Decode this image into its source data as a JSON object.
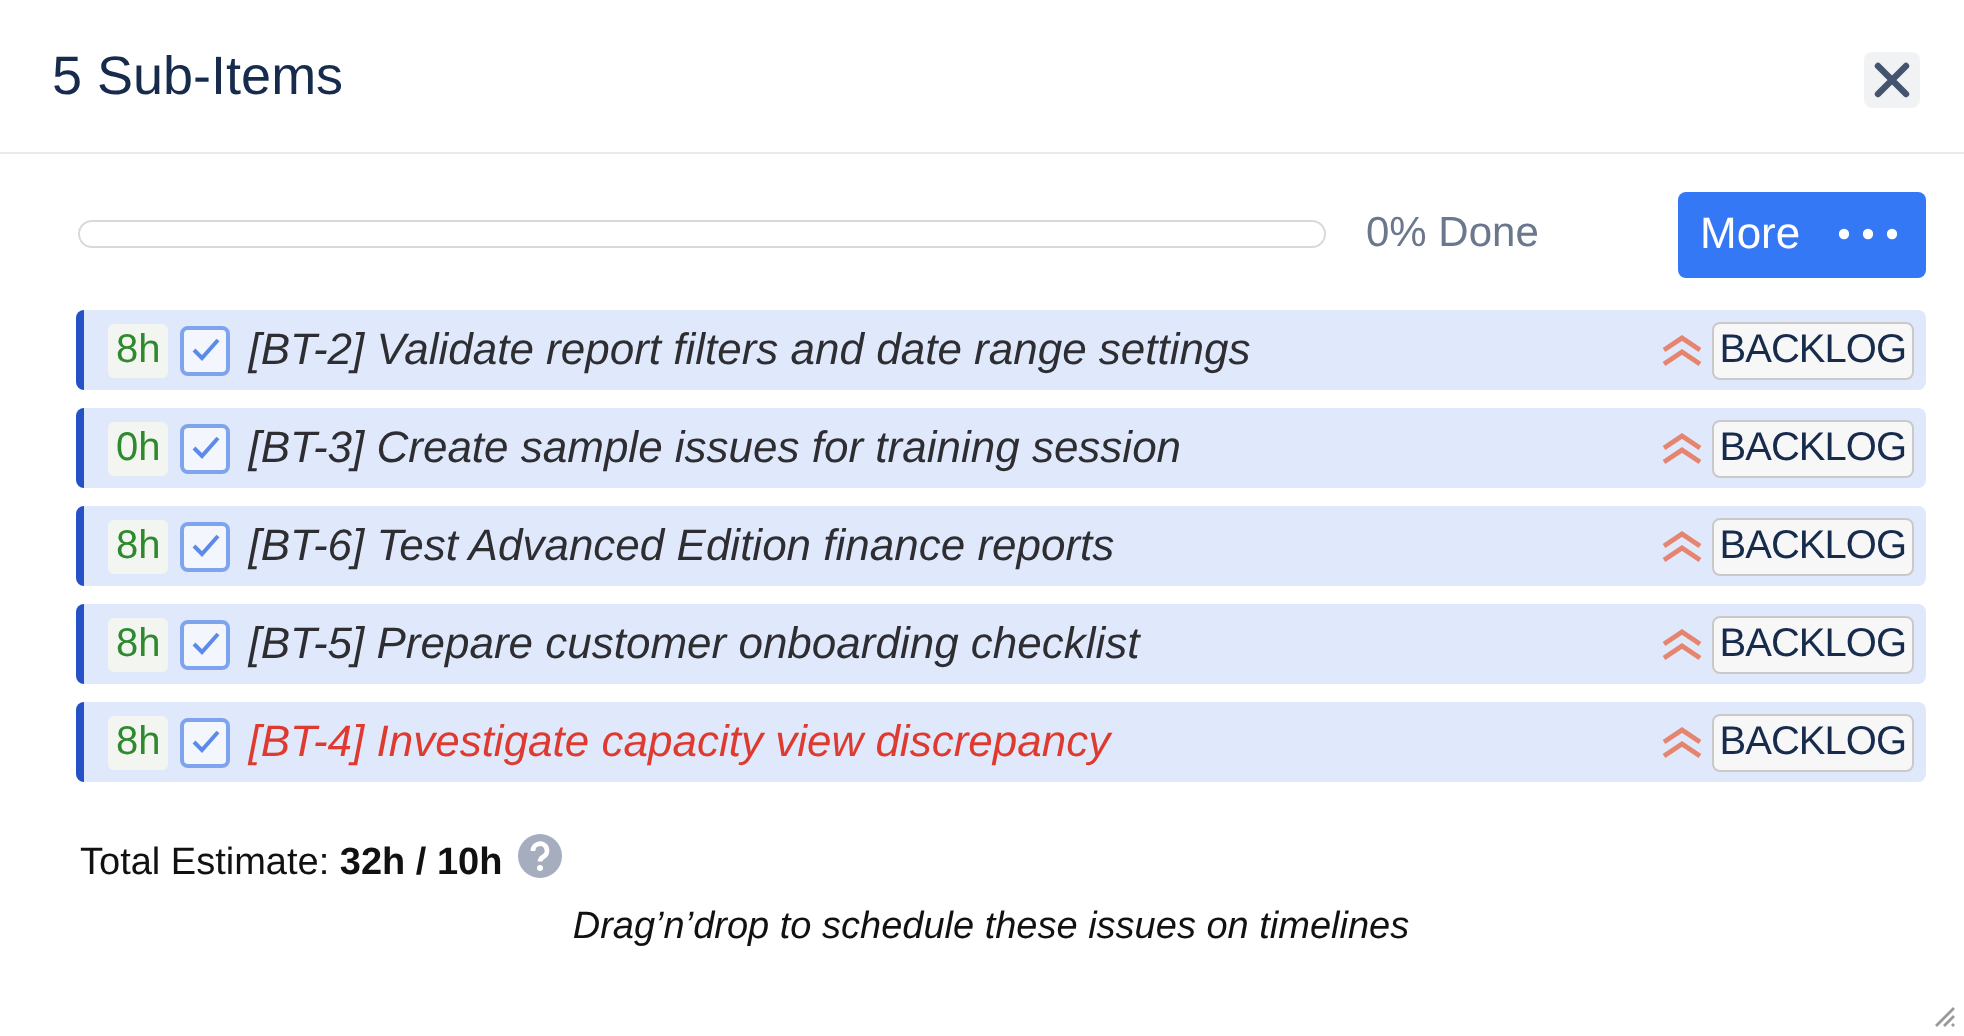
{
  "title": "5 Sub-Items",
  "progress": {
    "level": 0,
    "label": "0% Done"
  },
  "more_button": {
    "label": "More"
  },
  "items": [
    {
      "estimate": "8h",
      "checked": true,
      "title": "[BT-2] Validate report filters and date range settings",
      "overdue": false,
      "status": "BACKLOG"
    },
    {
      "estimate": "0h",
      "checked": true,
      "title": "[BT-3] Create sample issues for training session",
      "overdue": false,
      "status": "BACKLOG"
    },
    {
      "estimate": "8h",
      "checked": true,
      "title": "[BT-6] Test Advanced Edition finance reports",
      "overdue": false,
      "status": "BACKLOG"
    },
    {
      "estimate": "8h",
      "checked": true,
      "title": "[BT-5] Prepare customer onboarding checklist",
      "overdue": false,
      "status": "BACKLOG"
    },
    {
      "estimate": "8h",
      "checked": true,
      "title": "[BT-4] Investigate capacity view discrepancy",
      "overdue": true,
      "status": "BACKLOG"
    }
  ],
  "total_estimate": "Total Estimate: **32h / 10h**",
  "hint": "Drag’n’drop to schedule these issues on timelines"
}
